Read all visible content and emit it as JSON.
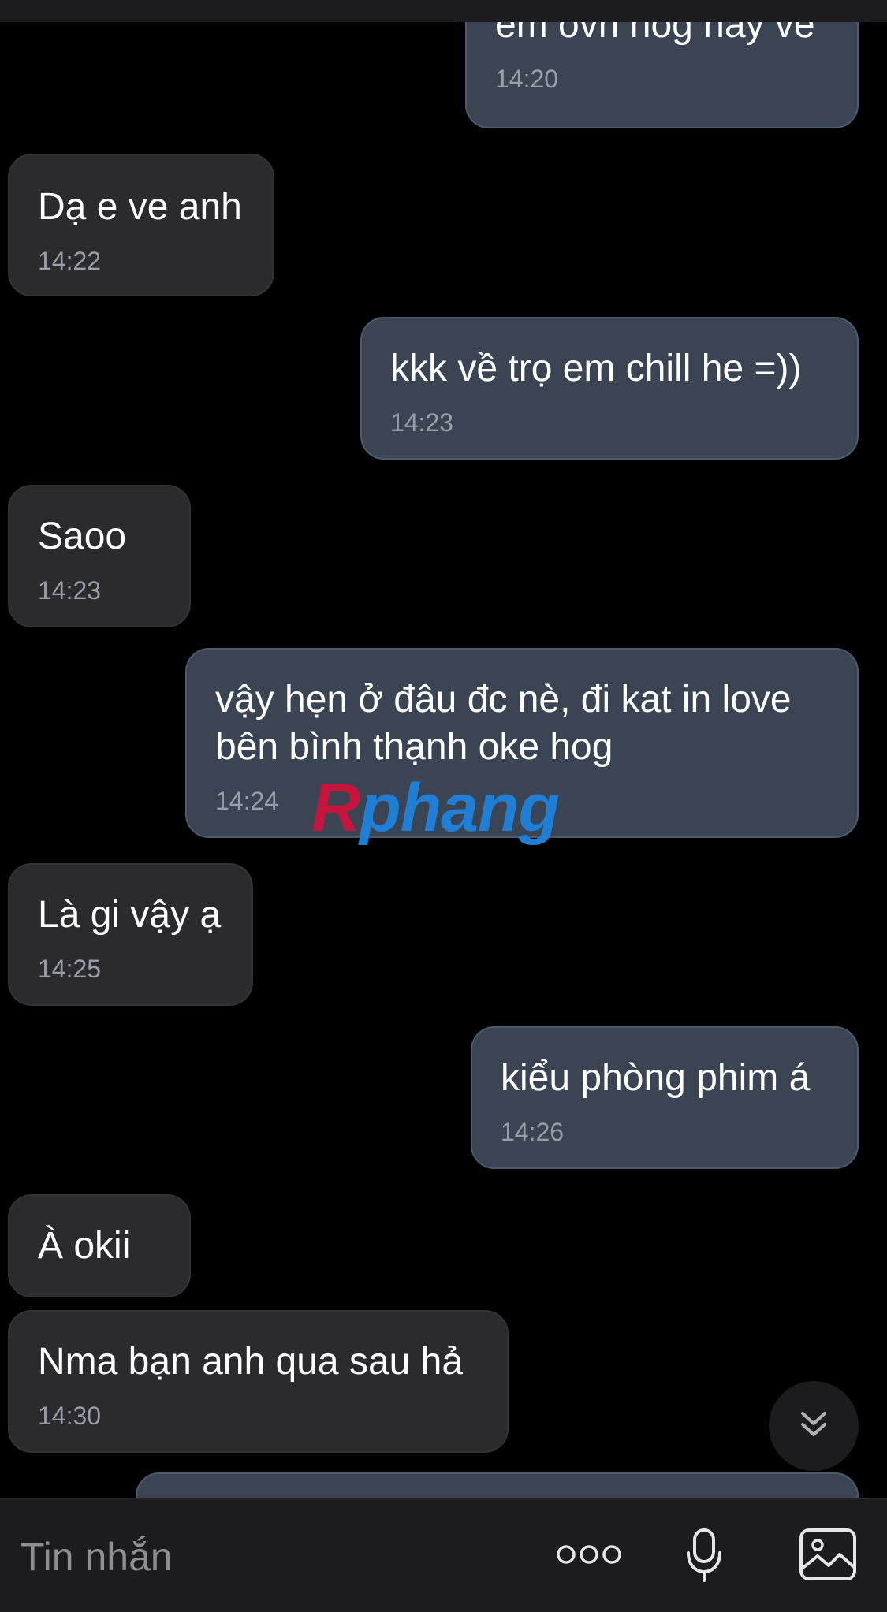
{
  "messages": [
    {
      "direction": "outgoing",
      "text": "em ovn hog hay vê",
      "time": "14:20"
    },
    {
      "direction": "incoming",
      "text": "Dạ e ve anh",
      "time": "14:22"
    },
    {
      "direction": "outgoing",
      "text": "kkk về trọ em chill he =))",
      "time": "14:23"
    },
    {
      "direction": "incoming",
      "text": "Saoo",
      "time": "14:23"
    },
    {
      "direction": "outgoing",
      "text_line1": "vậy hẹn ở đâu đc nè, đi kat in love",
      "text_line2": "bên bình thạnh oke hog",
      "time": "14:24"
    },
    {
      "direction": "incoming",
      "text": "Là gi vậy ạ",
      "time": "14:25"
    },
    {
      "direction": "outgoing",
      "text": "kiểu phòng phim á",
      "time": "14:26"
    },
    {
      "direction": "incoming",
      "text": "À okii"
    },
    {
      "direction": "incoming",
      "text": "Nma bạn anh qua sau hả",
      "time": "14:30"
    }
  ],
  "watermark": {
    "part1": "R",
    "part2": "phang"
  },
  "composer": {
    "placeholder": "Tin nhắn",
    "icons": [
      "more-options-icon",
      "microphone-icon",
      "image-icon"
    ]
  },
  "scroll_button": {
    "icon": "chevron-double-down-icon"
  },
  "colors": {
    "background": "#000000",
    "incoming_bubble": "#2b2b2d",
    "outgoing_bubble": "#3a4452",
    "timestamp": "#9a9ea6",
    "composer_bg": "#1c1c1e"
  }
}
